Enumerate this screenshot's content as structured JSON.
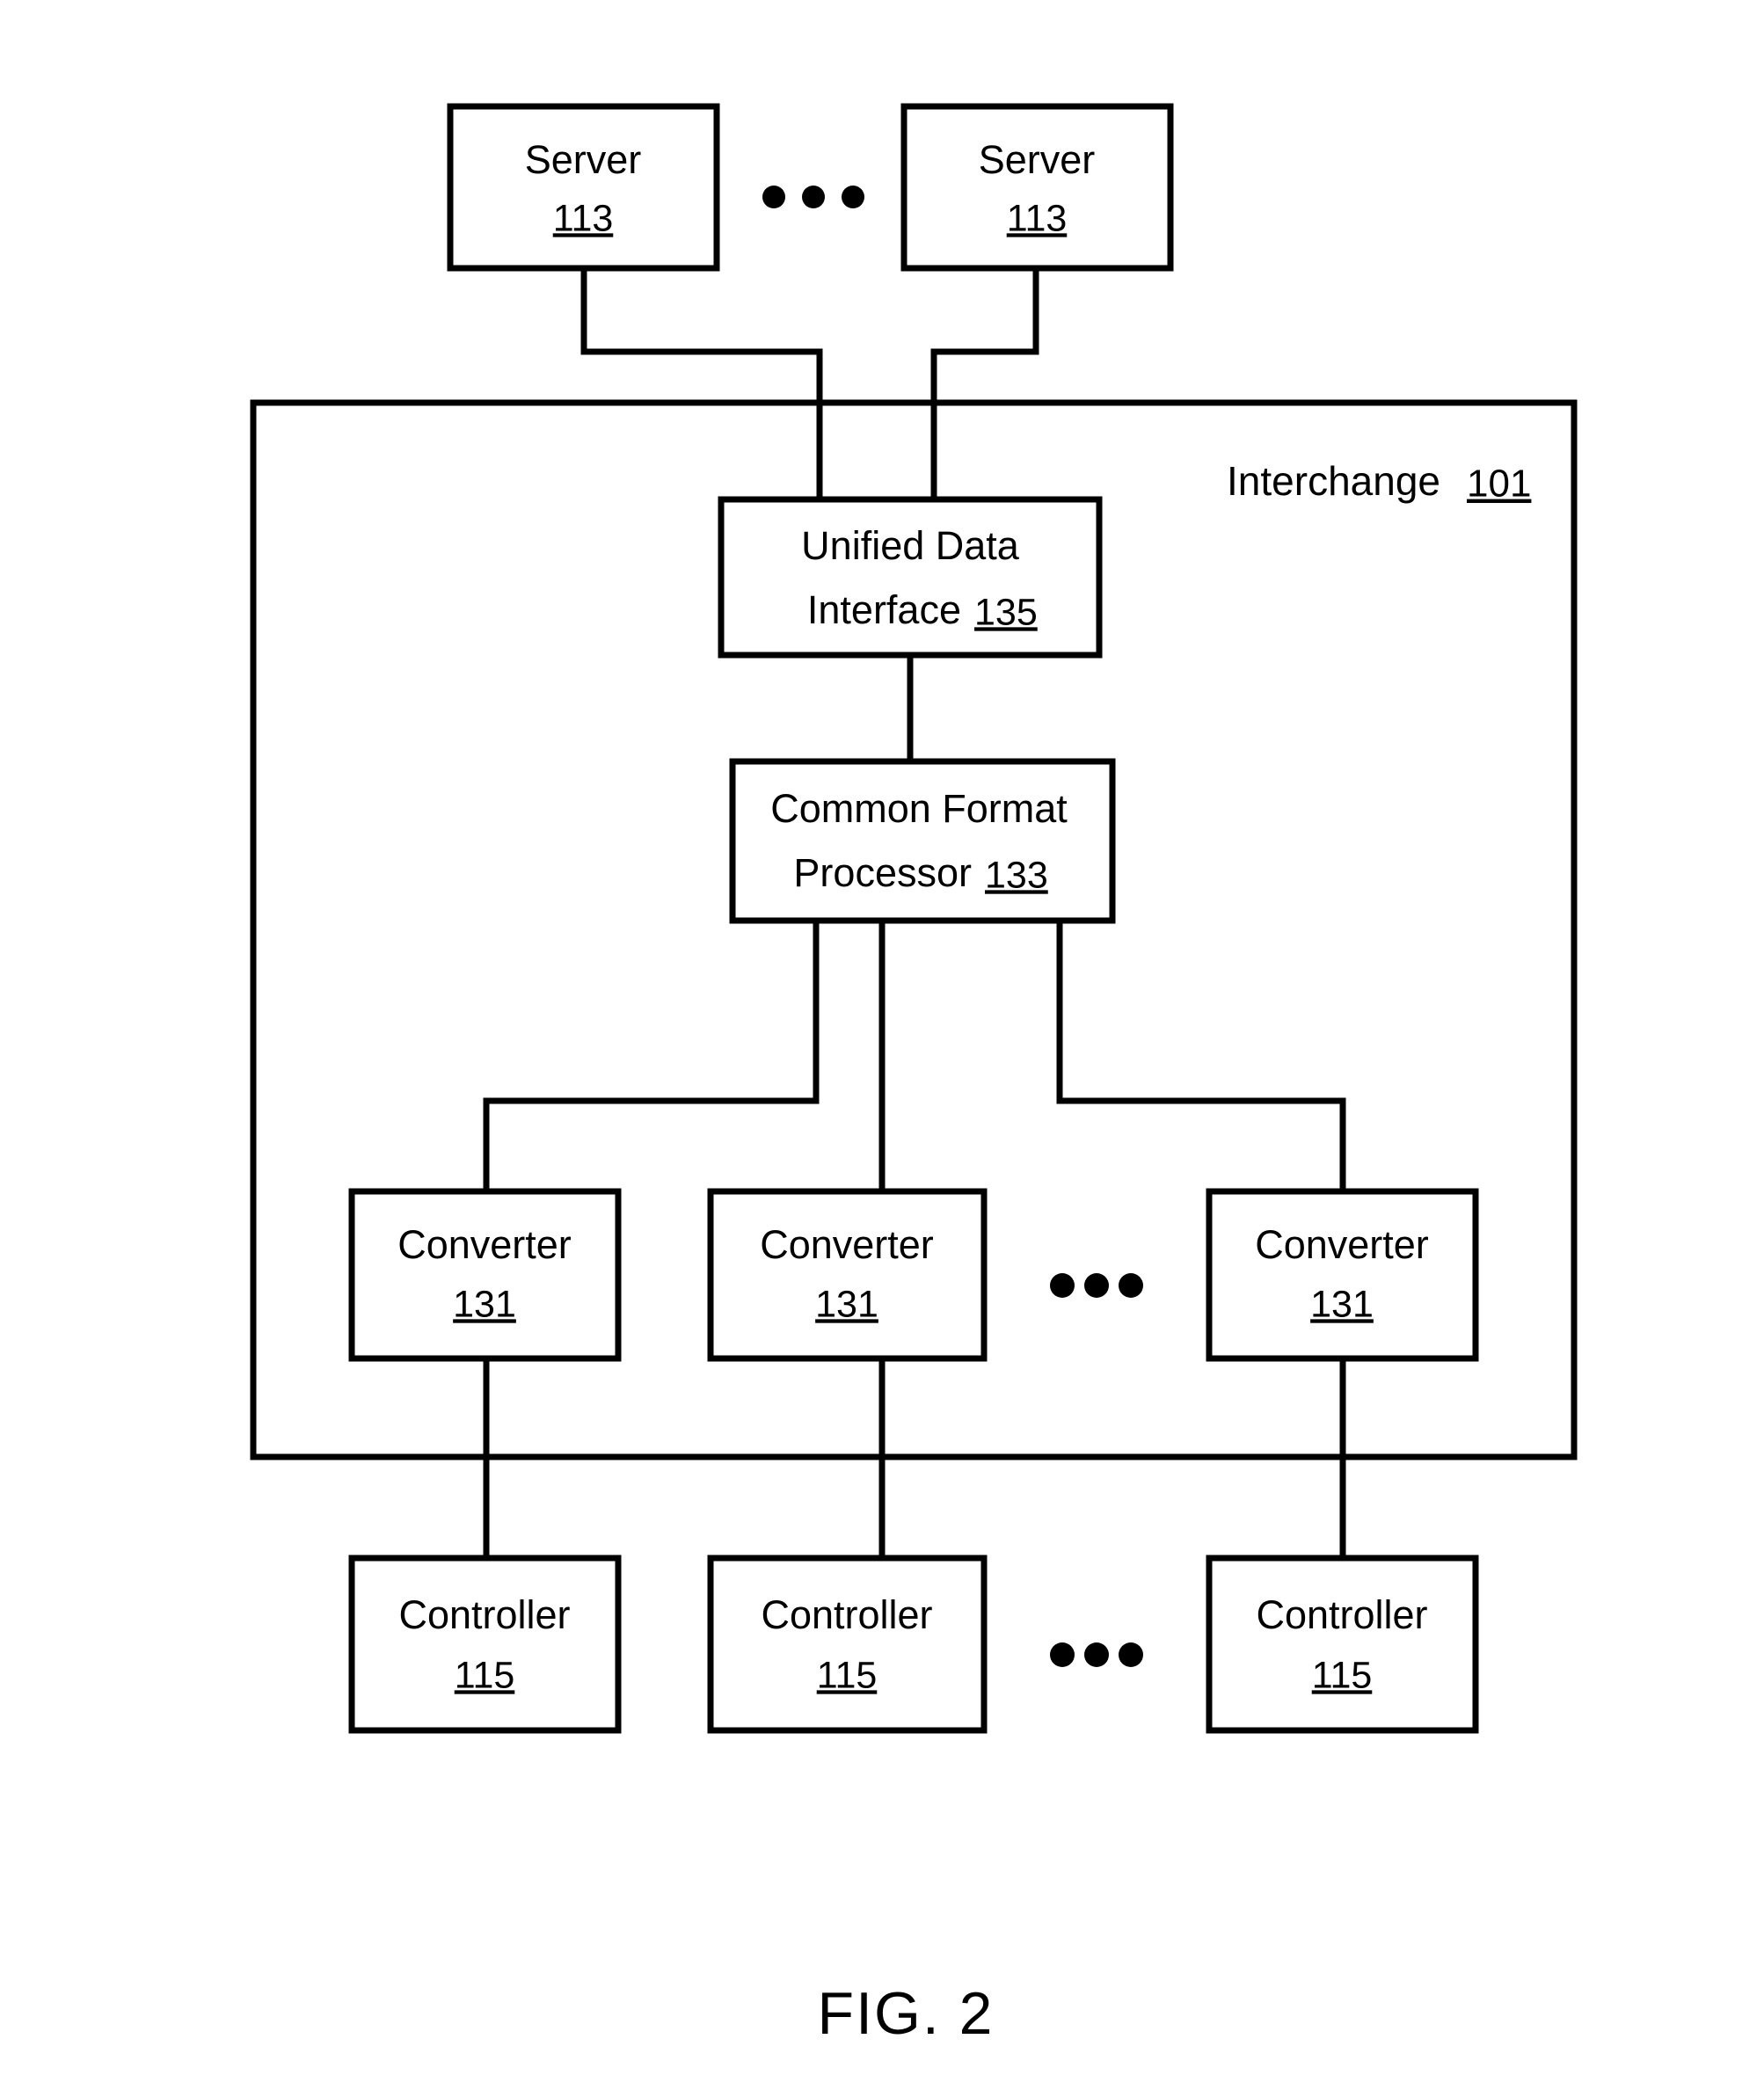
{
  "figure": {
    "caption": "FIG. 2"
  },
  "container": {
    "label": "Interchange",
    "ref": "101"
  },
  "servers": [
    {
      "label": "Server",
      "ref": "113"
    },
    {
      "label": "Server",
      "ref": "113"
    }
  ],
  "server_ellipsis": "•••",
  "unified_data_interface": {
    "line1": "Unified Data",
    "line2_label": "Interface",
    "ref": "135"
  },
  "common_format_processor": {
    "line1": "Common Format",
    "line2_label": "Processor",
    "ref": "133"
  },
  "converters": [
    {
      "label": "Converter",
      "ref": "131"
    },
    {
      "label": "Converter",
      "ref": "131"
    },
    {
      "label": "Converter",
      "ref": "131"
    }
  ],
  "converter_ellipsis": "•••",
  "controllers": [
    {
      "label": "Controller",
      "ref": "115"
    },
    {
      "label": "Controller",
      "ref": "115"
    },
    {
      "label": "Controller",
      "ref": "115"
    }
  ],
  "controller_ellipsis": "•••",
  "colors": {
    "stroke": "#000000",
    "fill": "#ffffff",
    "text": "#000000"
  }
}
